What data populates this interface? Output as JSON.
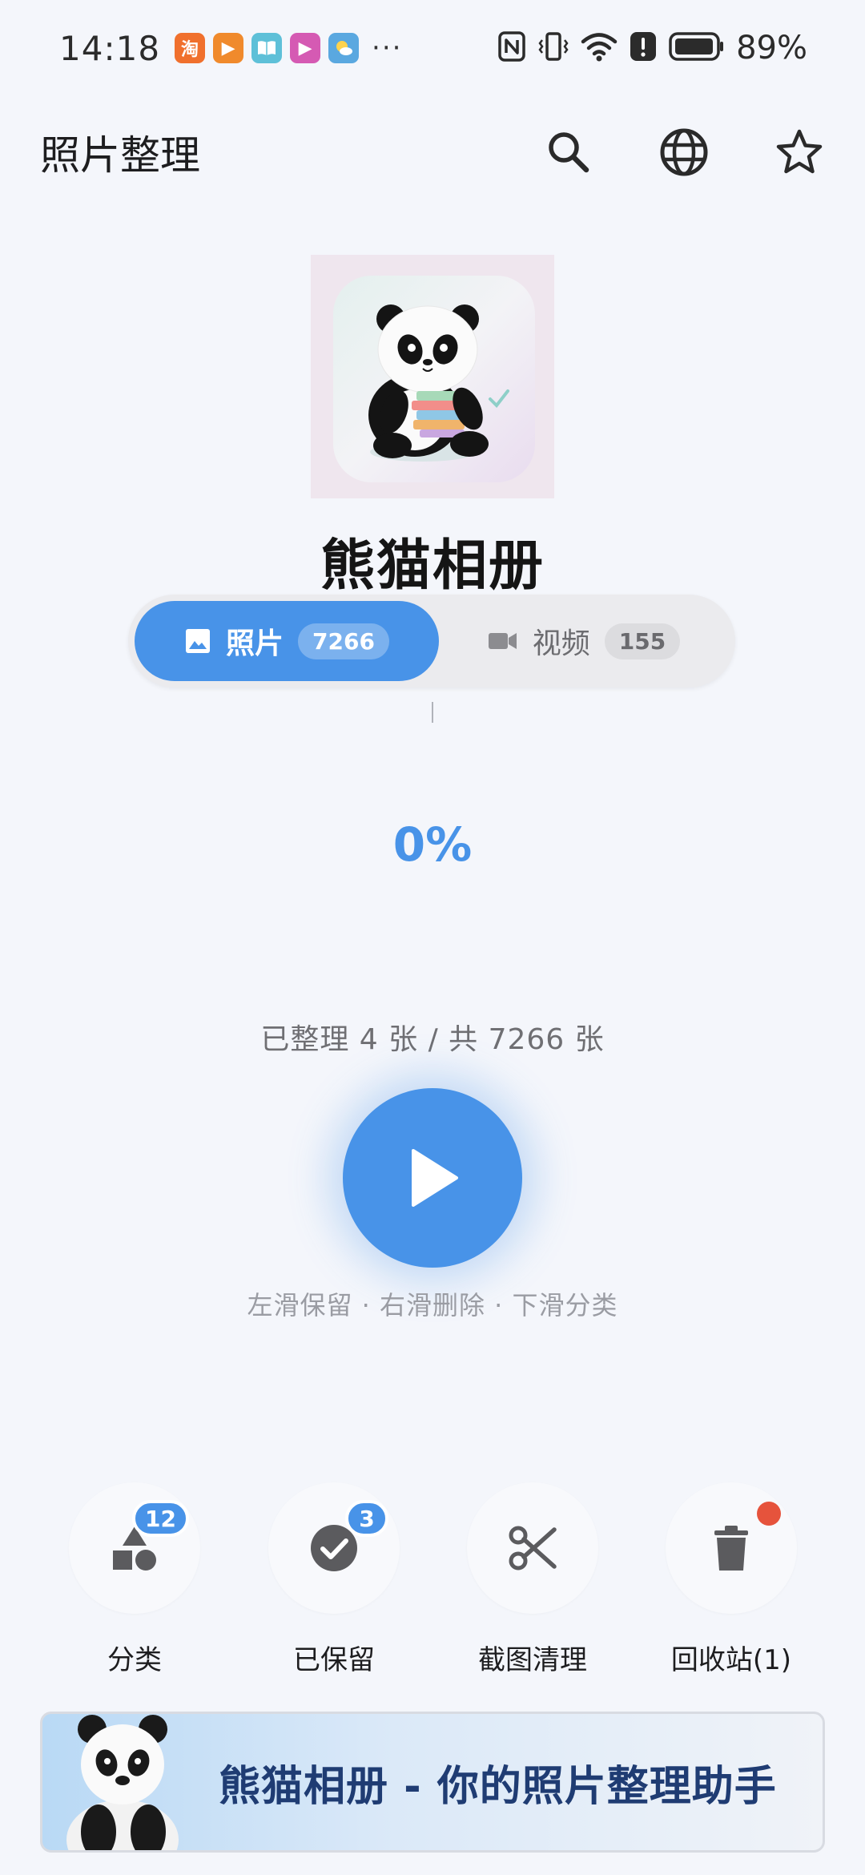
{
  "status_bar": {
    "time": "14:18",
    "apps": [
      {
        "name": "taobao-app-icon",
        "glyph": "淘",
        "color": "#f0702d"
      },
      {
        "name": "video-app-icon",
        "glyph": "▶",
        "color": "#f08a2c"
      },
      {
        "name": "reader-app-icon",
        "glyph": "📖",
        "color": "#5ec0d8"
      },
      {
        "name": "media-app-icon",
        "glyph": "▶",
        "color": "#d55ab3"
      },
      {
        "name": "weather-app-icon",
        "glyph": "☀",
        "color": "#5aa8e0"
      }
    ],
    "more": "···",
    "battery": "89%"
  },
  "app_bar": {
    "title": "照片整理"
  },
  "app_name": "熊猫相册",
  "tabs": [
    {
      "label": "照片",
      "count": "7266",
      "active": true
    },
    {
      "label": "视频",
      "count": "155",
      "active": false
    }
  ],
  "progress": {
    "percent_text": "0%",
    "count_text": "已整理 4 张 / 共 7266 张"
  },
  "hint": "左滑保留 · 右滑删除 · 下滑分类",
  "actions": [
    {
      "label": "分类",
      "badge": "12"
    },
    {
      "label": "已保留",
      "badge": "3"
    },
    {
      "label": "截图清理",
      "badge": ""
    },
    {
      "label": "回收站(1)",
      "badge": ""
    }
  ],
  "banner": {
    "text": "熊猫相册 - 你的照片整理助手"
  },
  "colors": {
    "accent": "#4893e8",
    "alert_dot": "#e6533c",
    "background": "#f4f6fb"
  }
}
